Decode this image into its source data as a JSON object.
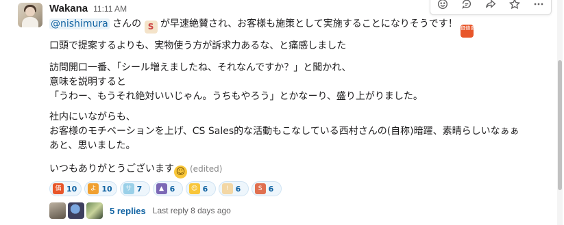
{
  "message": {
    "username": "Wakana",
    "timestamp": "11:11 AM",
    "mention": "@nishimura",
    "line1_after_mention": " さんの",
    "line1_rest": " が早速絶賛され、お客様も施策として実施することになりそうです！",
    "line2": "口頭で提案するよりも、実物使う方が訴求力あるな、と痛感しました",
    "line3": "訪問開口一番、「シール増えましたね、それなんですか？」と聞かれ、",
    "line4": "意味を説明すると",
    "line5": "「うわー、もうそれ絶対いいじゃん。うちもやろう」とかなーり、盛り上がりました。",
    "line6": "社内にいながらも、",
    "line7": "お客様のモチベーションを上げ、CS Sales的な活動もこなしている西村さんの(自称)暗躍、素晴らしいなぁぁ",
    "line8": "あと、思いました。",
    "line9": "いつもありがとうございます",
    "edited": "(edited)",
    "inline_emoji_sales": "sales-guy-emoji",
    "inline_emoji_value": "kachi-aru-emoji",
    "inline_emoji_value_text": "価値ある",
    "inline_emoji_smile": "smiling-face-emoji"
  },
  "reactions": [
    {
      "emoji": "kachi-aru",
      "label": "価値",
      "color": "#e8562a",
      "count": "10"
    },
    {
      "emoji": "yoi",
      "label": "よ",
      "color": "#f0a030",
      "count": "10"
    },
    {
      "emoji": "sales",
      "label": "サセ",
      "color": "#9ad0e8",
      "count": "7"
    },
    {
      "emoji": "tent",
      "label": "▲",
      "color": "#7b68b5",
      "count": "6"
    },
    {
      "emoji": "heart-eyes",
      "label": "😍",
      "color": "#f8c63a",
      "count": "6"
    },
    {
      "emoji": "sticker",
      "label": "!",
      "color": "#f3d7a5",
      "count": "6"
    },
    {
      "emoji": "sales-guy",
      "label": "S",
      "color": "#e07050",
      "count": "6"
    }
  ],
  "thread": {
    "reply_count": "5 replies",
    "last_reply": "Last reply 8 days ago"
  },
  "toolbar": {
    "icons": [
      "add-reaction-icon",
      "reply-in-thread-icon",
      "share-icon",
      "save-icon",
      "more-actions-icon"
    ]
  }
}
